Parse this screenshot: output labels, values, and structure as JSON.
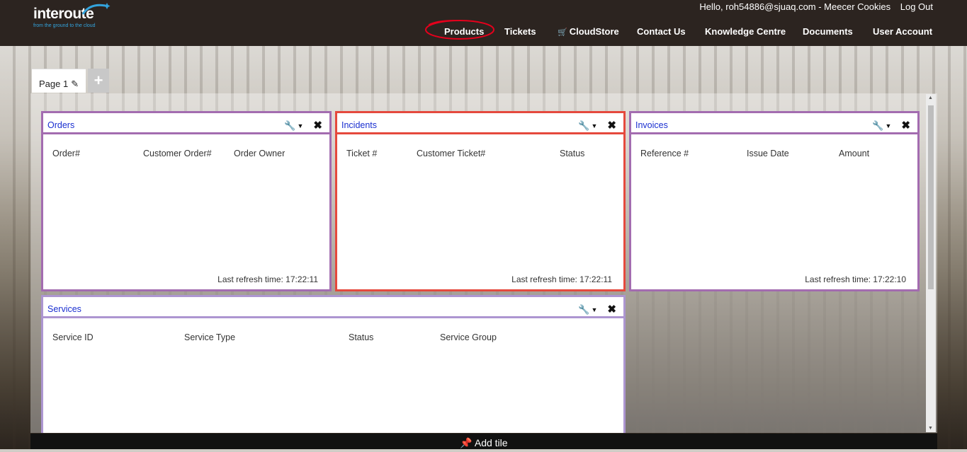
{
  "header": {
    "logo_text": "interoute",
    "logo_tagline": "from the ground to the cloud",
    "greeting": "Hello, roh54886@sjuaq.com - Meecer Cookies",
    "logout_label": "Log Out",
    "nav": [
      "Products",
      "Tickets",
      "CloudStore",
      "Contact Us",
      "Knowledge Centre",
      "Documents",
      "User Account"
    ],
    "highlight_color": "#e5001c"
  },
  "tabs": {
    "page_label": "Page 1",
    "add_label": "+"
  },
  "tiles": {
    "orders": {
      "title": "Orders",
      "columns": [
        "Order#",
        "Customer Order#",
        "Order Owner"
      ],
      "refresh": "Last refresh time: 17:22:11"
    },
    "incidents": {
      "title": "Incidents",
      "columns": [
        "Ticket #",
        "Customer Ticket#",
        "Status"
      ],
      "refresh": "Last refresh time: 17:22:11"
    },
    "invoices": {
      "title": "Invoices",
      "columns": [
        "Reference #",
        "Issue Date",
        "Amount"
      ],
      "refresh": "Last refresh time: 17:22:10"
    },
    "services": {
      "title": "Services",
      "columns": [
        "Service ID",
        "Service Type",
        "Status",
        "Service Group"
      ]
    }
  },
  "footer": {
    "add_tile_label": "Add tile"
  },
  "colors": {
    "topbar": "#2c2420",
    "tile_border_purple": "#a36cb0",
    "tile_border_red": "#e5493d",
    "tile_border_lavender": "#ad96d1",
    "tile_title": "#1a2fd0"
  }
}
